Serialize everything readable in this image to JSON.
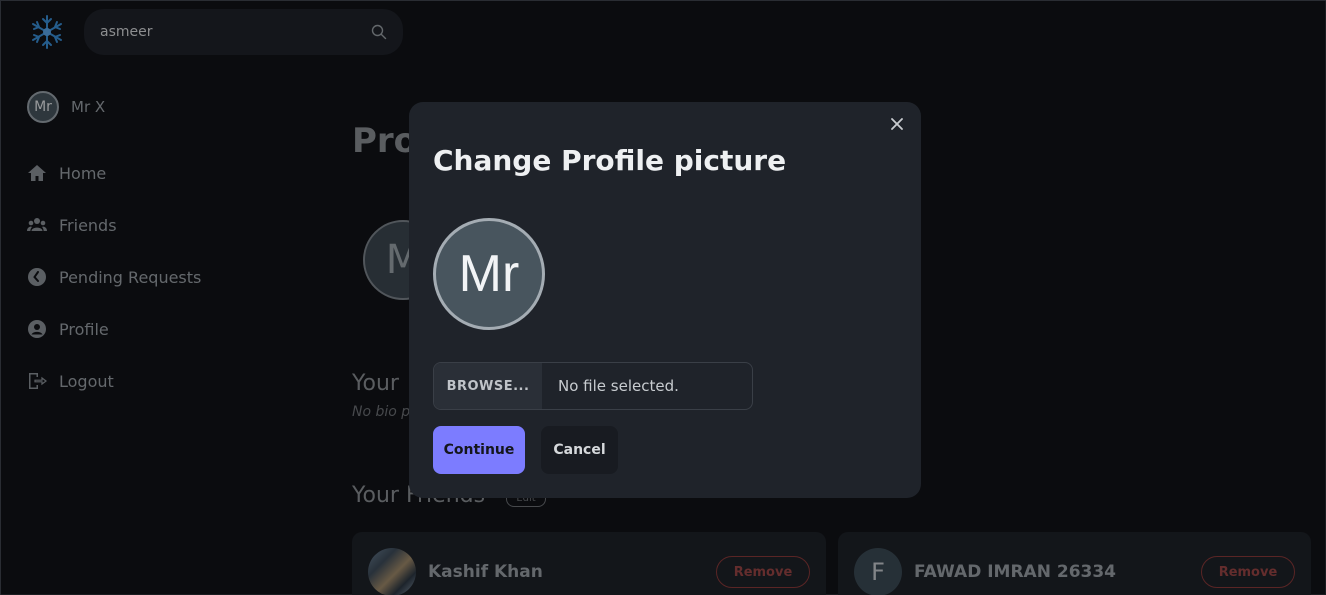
{
  "header": {
    "logo_icon": "snowflake-icon",
    "search": {
      "value": "asmeer",
      "icon": "search-icon"
    }
  },
  "sidebar": {
    "user": {
      "initials": "Mr",
      "name": "Mr X"
    },
    "items": [
      {
        "label": "Home",
        "icon": "home-icon"
      },
      {
        "label": "Friends",
        "icon": "friends-icon"
      },
      {
        "label": "Pending Requests",
        "icon": "clock-icon"
      },
      {
        "label": "Profile",
        "icon": "user-circle-icon"
      },
      {
        "label": "Logout",
        "icon": "logout-icon"
      }
    ]
  },
  "main": {
    "title": "Pro",
    "avatar_initials": "M",
    "bio_title": "Your",
    "bio_text": "No bio p",
    "friends_title": "Your Friends",
    "edit_label": "Edit",
    "friends": [
      {
        "name": "Kashif Khan",
        "initials": "",
        "remove_label": "Remove"
      },
      {
        "name": "FAWAD IMRAN 26334",
        "initials": "F",
        "remove_label": "Remove"
      }
    ]
  },
  "modal": {
    "title": "Change Profile picture",
    "avatar_initials": "Mr",
    "browse_label": "BROWSE...",
    "file_status": "No file selected.",
    "continue_label": "Continue",
    "cancel_label": "Cancel"
  },
  "colors": {
    "accent": "#7c7cff",
    "background": "#111318",
    "surface": "#1f232a",
    "danger": "#8a3a3a"
  }
}
